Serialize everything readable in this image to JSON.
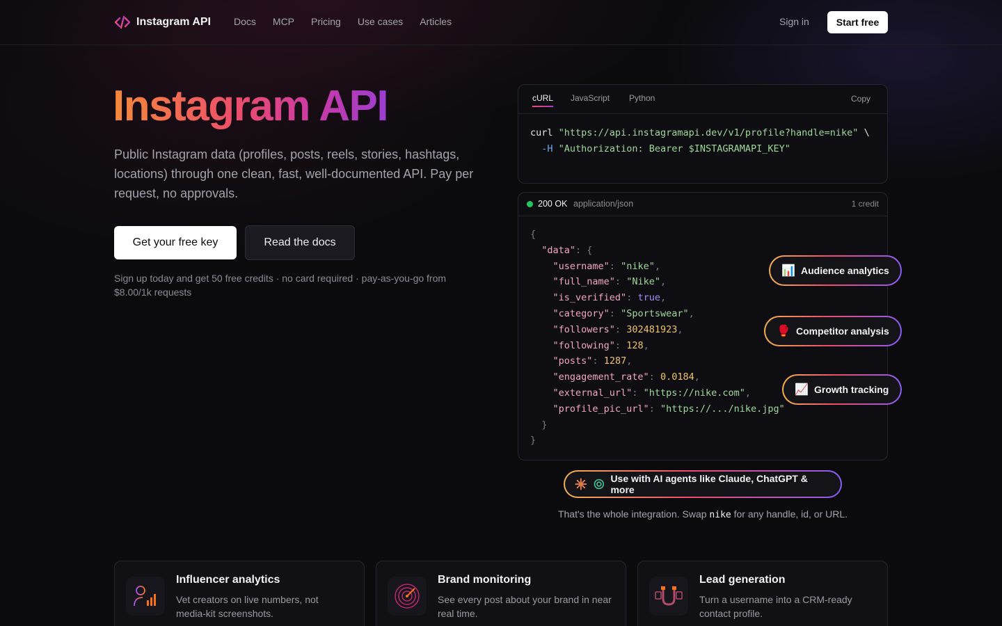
{
  "nav": {
    "brand": "Instagram API",
    "links": [
      "Docs",
      "MCP",
      "Pricing",
      "Use cases",
      "Articles"
    ],
    "sign_in": "Sign in",
    "start_free": "Start free"
  },
  "hero": {
    "title": "Instagram API",
    "subtitle": "Public Instagram data (profiles, posts, reels, stories, hashtags, locations) through one clean, fast, well-documented API. Pay per request, no approvals.",
    "primary_cta": "Get your free key",
    "secondary_cta": "Read the docs",
    "note": "Sign up today and get 50 free credits · no card required · pay-as-you-go from $8.00/1k requests"
  },
  "code": {
    "tabs": [
      "cURL",
      "JavaScript",
      "Python"
    ],
    "active_tab": "cURL",
    "copy": "Copy",
    "line1_cmd": "curl",
    "line1_url": "\"https://api.instagramapi.dev/v1/profile?handle=nike\"",
    "line1_cont": "\\",
    "line2_flag": "-H",
    "line2_header": "\"Authorization: Bearer $INSTAGRAMAPI_KEY\""
  },
  "response": {
    "status": "200 OK",
    "content_type": "application/json",
    "credits": "1 credit",
    "fields": [
      {
        "key": "\"username\"",
        "value": "\"nike\"",
        "kind": "str"
      },
      {
        "key": "\"full_name\"",
        "value": "\"Nike\"",
        "kind": "str"
      },
      {
        "key": "\"is_verified\"",
        "value": "true",
        "kind": "bool"
      },
      {
        "key": "\"category\"",
        "value": "\"Sportswear\"",
        "kind": "str"
      },
      {
        "key": "\"followers\"",
        "value": "302481923",
        "kind": "num"
      },
      {
        "key": "\"following\"",
        "value": "128",
        "kind": "num"
      },
      {
        "key": "\"posts\"",
        "value": "1287",
        "kind": "num"
      },
      {
        "key": "\"engagement_rate\"",
        "value": "0.0184",
        "kind": "num"
      },
      {
        "key": "\"external_url\"",
        "value": "\"https://nike.com\"",
        "kind": "str"
      },
      {
        "key": "\"profile_pic_url\"",
        "value": "\"https://.../nike.jpg\"",
        "kind": "str"
      }
    ]
  },
  "pills": {
    "audience": {
      "label": "Audience analytics",
      "icon": "bar-chart-icon"
    },
    "competitor": {
      "label": "Competitor analysis",
      "icon": "boxing-glove-icon"
    },
    "growth": {
      "label": "Growth tracking",
      "icon": "trending-up-icon"
    }
  },
  "agents": {
    "label": "Use with AI agents like Claude, ChatGPT & more",
    "note_before": "That's the whole integration. Swap",
    "note_code": "nike",
    "note_after": "for any handle, id, or URL."
  },
  "features": [
    {
      "title": "Influencer analytics",
      "desc": "Vet creators on live numbers, not media-kit screenshots.",
      "icon": "influencer-icon"
    },
    {
      "title": "Brand monitoring",
      "desc": "See every post about your brand in near real time.",
      "icon": "radar-icon"
    },
    {
      "title": "Lead generation",
      "desc": "Turn a username into a CRM-ready contact profile.",
      "icon": "magnet-icon"
    }
  ],
  "colors": {
    "accent_orange": "#f58a3a",
    "accent_pink": "#ee4d6b",
    "accent_purple": "#9b3ed0",
    "status_green": "#22c55e"
  }
}
